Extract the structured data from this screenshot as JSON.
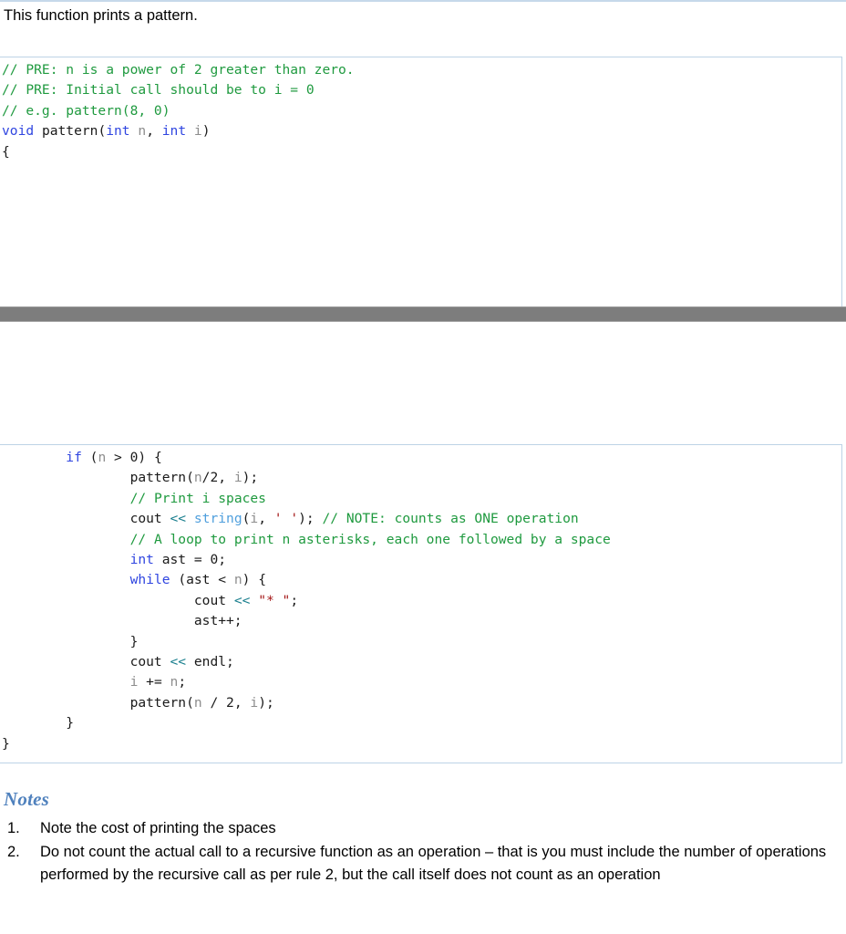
{
  "page": {
    "intro_text": "This function prints a pattern.",
    "border_color": "#bdd3e6",
    "gray_bar_color": "#7d7d7d",
    "accent_color": "#4f81bd"
  },
  "code_block_1": {
    "lines": [
      [
        {
          "t": "// PRE: n is a power of 2 greater than zero.",
          "c": "comment"
        }
      ],
      [
        {
          "t": "// PRE: Initial call should be to i = 0",
          "c": "comment"
        }
      ],
      [
        {
          "t": "// e.g. pattern(8, 0)",
          "c": "comment"
        }
      ],
      [
        {
          "t": "void",
          "c": "keyword"
        },
        {
          "t": " pattern(",
          "c": "plain"
        },
        {
          "t": "int",
          "c": "type"
        },
        {
          "t": " ",
          "c": "plain"
        },
        {
          "t": "n",
          "c": "ident"
        },
        {
          "t": ", ",
          "c": "plain"
        },
        {
          "t": "int",
          "c": "type"
        },
        {
          "t": " ",
          "c": "plain"
        },
        {
          "t": "i",
          "c": "ident"
        },
        {
          "t": ")",
          "c": "plain"
        }
      ],
      [
        {
          "t": "{",
          "c": "plain"
        }
      ]
    ]
  },
  "code_block_2": {
    "lines": [
      [
        {
          "t": "        ",
          "c": "plain"
        },
        {
          "t": "if",
          "c": "keyword"
        },
        {
          "t": " (",
          "c": "plain"
        },
        {
          "t": "n",
          "c": "ident"
        },
        {
          "t": " > 0) {",
          "c": "plain"
        }
      ],
      [
        {
          "t": "                pattern(",
          "c": "plain"
        },
        {
          "t": "n",
          "c": "ident"
        },
        {
          "t": "/2, ",
          "c": "plain"
        },
        {
          "t": "i",
          "c": "ident"
        },
        {
          "t": ");",
          "c": "plain"
        }
      ],
      [
        {
          "t": "                ",
          "c": "plain"
        },
        {
          "t": "// Print i spaces",
          "c": "comment"
        }
      ],
      [
        {
          "t": "                cout ",
          "c": "plain"
        },
        {
          "t": "<<",
          "c": "op"
        },
        {
          "t": " ",
          "c": "plain"
        },
        {
          "t": "string",
          "c": "func"
        },
        {
          "t": "(",
          "c": "plain"
        },
        {
          "t": "i",
          "c": "ident"
        },
        {
          "t": ", ",
          "c": "plain"
        },
        {
          "t": "' '",
          "c": "string"
        },
        {
          "t": "); ",
          "c": "plain"
        },
        {
          "t": "// NOTE: counts as ONE operation",
          "c": "comment"
        }
      ],
      [
        {
          "t": "                ",
          "c": "plain"
        },
        {
          "t": "// A loop to print n asterisks, each one followed by a space",
          "c": "comment"
        }
      ],
      [
        {
          "t": "                ",
          "c": "plain"
        },
        {
          "t": "int",
          "c": "type"
        },
        {
          "t": " ast = 0;",
          "c": "plain"
        }
      ],
      [
        {
          "t": "                ",
          "c": "plain"
        },
        {
          "t": "while",
          "c": "keyword"
        },
        {
          "t": " (ast < ",
          "c": "plain"
        },
        {
          "t": "n",
          "c": "ident"
        },
        {
          "t": ") {",
          "c": "plain"
        }
      ],
      [
        {
          "t": "                        cout ",
          "c": "plain"
        },
        {
          "t": "<<",
          "c": "op"
        },
        {
          "t": " ",
          "c": "plain"
        },
        {
          "t": "\"* \"",
          "c": "string"
        },
        {
          "t": ";",
          "c": "plain"
        }
      ],
      [
        {
          "t": "                        ast++;",
          "c": "plain"
        }
      ],
      [
        {
          "t": "                }",
          "c": "plain"
        }
      ],
      [
        {
          "t": "                cout ",
          "c": "plain"
        },
        {
          "t": "<<",
          "c": "op"
        },
        {
          "t": " endl;",
          "c": "plain"
        }
      ],
      [
        {
          "t": "                ",
          "c": "plain"
        },
        {
          "t": "i",
          "c": "ident"
        },
        {
          "t": " += ",
          "c": "plain"
        },
        {
          "t": "n",
          "c": "ident"
        },
        {
          "t": ";",
          "c": "plain"
        }
      ],
      [
        {
          "t": "                pattern(",
          "c": "plain"
        },
        {
          "t": "n",
          "c": "ident"
        },
        {
          "t": " / 2, ",
          "c": "plain"
        },
        {
          "t": "i",
          "c": "ident"
        },
        {
          "t": ");",
          "c": "plain"
        }
      ],
      [
        {
          "t": "        }",
          "c": "plain"
        }
      ],
      [
        {
          "t": "}",
          "c": "plain"
        }
      ]
    ]
  },
  "notes": {
    "heading": "Notes",
    "items": [
      {
        "number": "1.",
        "text": "Note the cost of printing the spaces"
      },
      {
        "number": "2.",
        "text": "Do not count the actual call to a recursive function as an operation – that is you must include the number of operations performed by the recursive call as per rule 2, but the call itself does not count as an operation"
      }
    ]
  }
}
